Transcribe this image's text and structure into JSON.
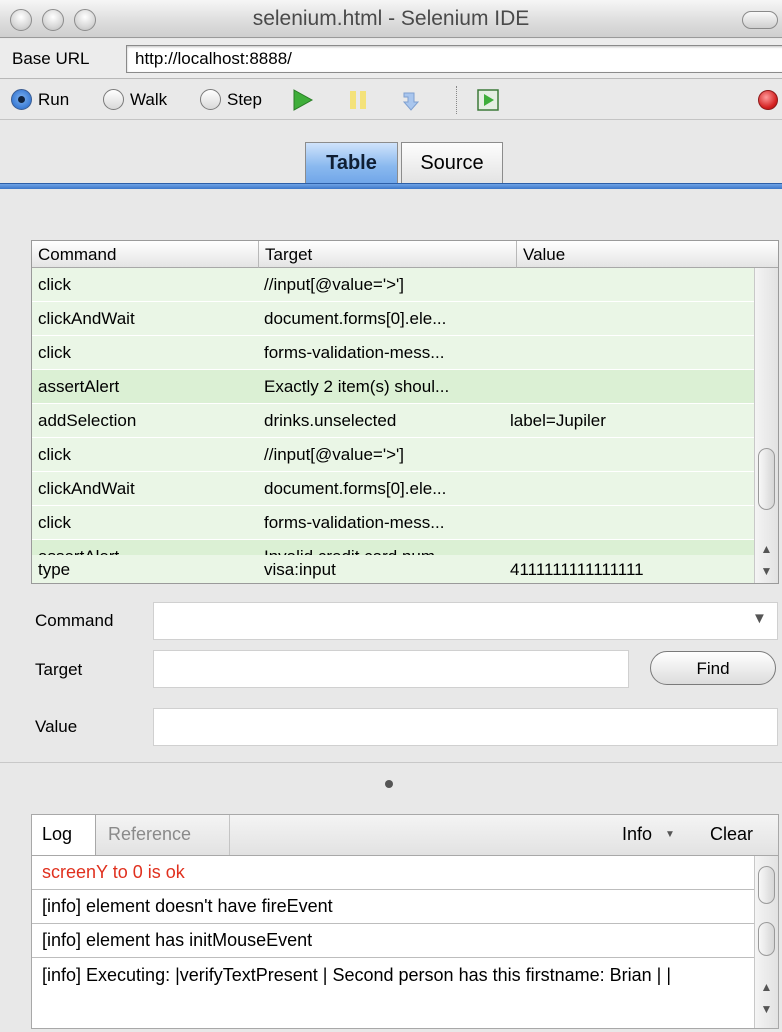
{
  "window": {
    "title": "selenium.html - Selenium IDE"
  },
  "base_url": {
    "label": "Base URL",
    "value": "http://localhost:8888/"
  },
  "run_controls": {
    "run_label": "Run",
    "walk_label": "Walk",
    "step_label": "Step",
    "selected": "Run"
  },
  "tabs": {
    "table_label": "Table",
    "source_label": "Source",
    "active": "Table"
  },
  "commands_table": {
    "headers": [
      "Command",
      "Target",
      "Value"
    ],
    "rows": [
      {
        "command": "click",
        "target": "//input[@value='>']",
        "value": ""
      },
      {
        "command": "clickAndWait",
        "target": "document.forms[0].ele...",
        "value": ""
      },
      {
        "command": "click",
        "target": "forms-validation-mess...",
        "value": ""
      },
      {
        "command": "assertAlert",
        "target": "Exactly 2 item(s) shoul...",
        "value": ""
      },
      {
        "command": "addSelection",
        "target": "drinks.unselected",
        "value": "label=Jupiler"
      },
      {
        "command": "click",
        "target": "//input[@value='>']",
        "value": ""
      },
      {
        "command": "clickAndWait",
        "target": "document.forms[0].ele...",
        "value": ""
      },
      {
        "command": "click",
        "target": "forms-validation-mess...",
        "value": ""
      },
      {
        "command": "assertAlert",
        "target": "Invalid credit card num...",
        "value": ""
      },
      {
        "command": "type",
        "target": "visa:input",
        "value": "4111111111111111"
      }
    ]
  },
  "editor": {
    "command_label": "Command",
    "target_label": "Target",
    "value_label": "Value",
    "command_value": "",
    "target_value": "",
    "value_value": "",
    "find_label": "Find"
  },
  "log_panel": {
    "tab_log": "Log",
    "tab_reference": "Reference",
    "info_label": "Info",
    "clear_label": "Clear",
    "entries": [
      {
        "text": "screenY to 0 is ok",
        "color": "#e0301e"
      },
      {
        "text": "[info] element doesn't have fireEvent",
        "color": "#000000"
      },
      {
        "text": "[info] element has initMouseEvent",
        "color": "#000000"
      },
      {
        "text": "[info] Executing: |verifyTextPresent | Second person has this firstname: Brian | |",
        "color": "#000000"
      }
    ]
  },
  "colors": {
    "row_green": "#eaf6e6",
    "row_green_alt": "#dbf0d4",
    "accent_blue": "#3c77c8",
    "error_red": "#e0301e"
  }
}
